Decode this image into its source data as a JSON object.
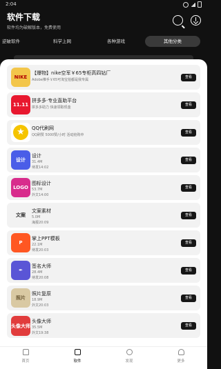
{
  "status_bar": {
    "time": "2:04"
  },
  "header": {
    "title": "软件下载",
    "subtitle": "软件均为破解版本，免费使用"
  },
  "tabs": [
    {
      "label": "逆破软件"
    },
    {
      "label": "科学上网"
    },
    {
      "label": "各种游戏"
    },
    {
      "label": "其他分类",
      "active": true
    }
  ],
  "items": [
    {
      "name": "【爆物】nike空军￥65专柜高四钻厂",
      "line2": "Adobe推手￥65可淘宝拍都是我专属",
      "line3": "",
      "button": "查看",
      "icon_text": "NIKE",
      "icon": "nike-icon"
    },
    {
      "name": "拼多多·专业直助平台",
      "line2": "拼多多助力 快速领取现金",
      "line3": "",
      "button": "查看",
      "icon_text": "11.11",
      "icon": "pinduoduo-icon"
    },
    {
      "name": "QQ代刷网",
      "line2": "QQ刷赞 5000赞/小时 活动抢购中",
      "line3": "",
      "button": "查看",
      "icon_text": "★",
      "icon": "star-icon"
    },
    {
      "name": "设计",
      "line2": "31.4M",
      "line3": "待发14:02",
      "button": "查看",
      "icon_text": "设计",
      "icon": "design-icon"
    },
    {
      "name": "图标设计",
      "line2": "53.7M",
      "line3": "外文14:00",
      "button": "查看",
      "icon_text": "LOGO",
      "icon": "logo-icon"
    },
    {
      "name": "文案素材",
      "line2": "5.0M",
      "line3": "海报20:09",
      "button": "查看",
      "icon_text": "文案",
      "icon": "text-icon"
    },
    {
      "name": "掌上PPT模板",
      "line2": "22.1M",
      "line3": "待发20:03",
      "button": "查看",
      "icon_text": "P",
      "icon": "ppt-icon"
    },
    {
      "name": "签名大师",
      "line2": "28.4M",
      "line3": "待发20:08",
      "button": "查看",
      "icon_text": "✒",
      "icon": "pen-icon"
    },
    {
      "name": "照片复原",
      "line2": "18.9M",
      "line3": "外文20:03",
      "button": "查看",
      "icon_text": "照片",
      "icon": "photo-icon"
    },
    {
      "name": "头像大师",
      "line2": "35.5M",
      "line3": "外文19:38",
      "button": "查看",
      "icon_text": "头像大师",
      "icon": "avatar-icon"
    }
  ],
  "bottom_nav": [
    {
      "label": "首页",
      "icon": "home-icon"
    },
    {
      "label": "软件",
      "icon": "box-icon",
      "active": true
    },
    {
      "label": "发现",
      "icon": "compass-icon"
    },
    {
      "label": "更多",
      "icon": "user-icon"
    }
  ],
  "colors": {
    "accent": "#111111",
    "sheet": "#ffffff",
    "card": "#f2f2f2"
  }
}
